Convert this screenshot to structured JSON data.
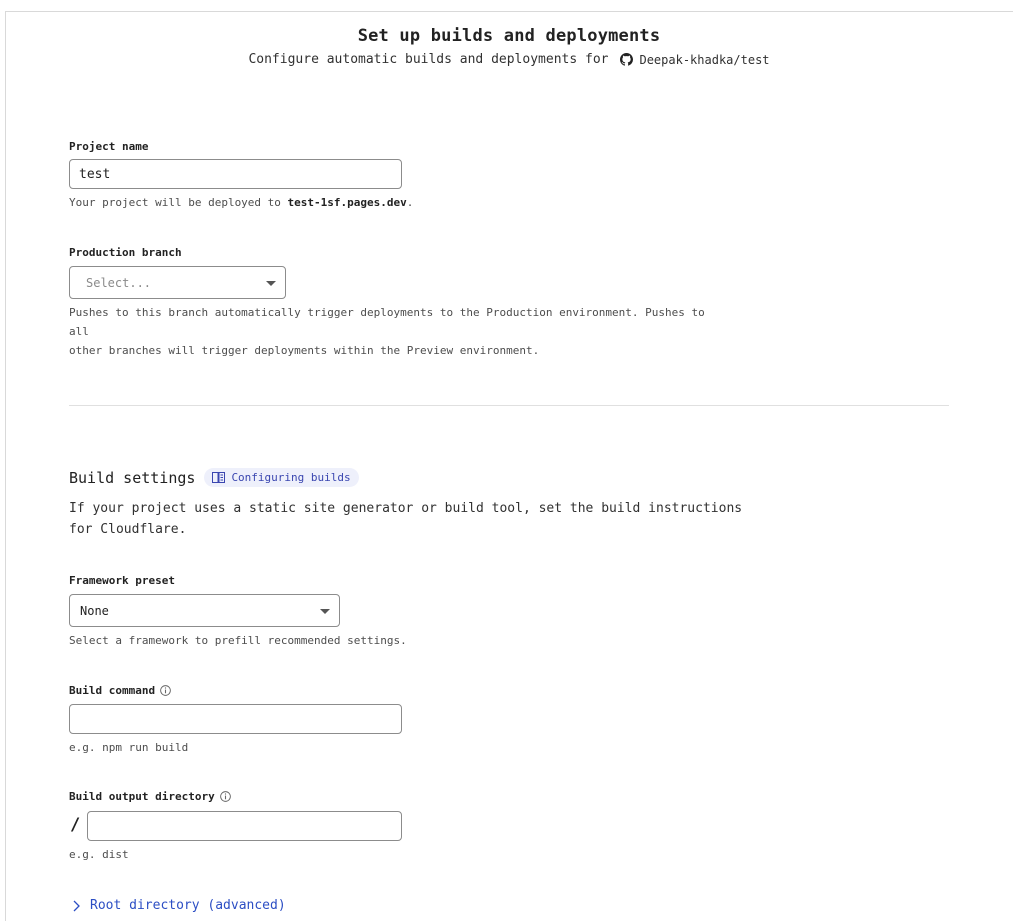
{
  "header": {
    "title": "Set up builds and deployments",
    "subtitle_prefix": "Configure automatic builds and deployments for",
    "repo": "Deepak-khadka/test",
    "repo_icon": "github-icon"
  },
  "project_name": {
    "label": "Project name",
    "value": "test",
    "help_prefix": "Your project will be deployed to ",
    "help_domain": "test-1sf.pages.dev",
    "help_suffix": "."
  },
  "production_branch": {
    "label": "Production branch",
    "placeholder": "Select...",
    "help_line1": "Pushes to this branch automatically trigger deployments to the Production environment. Pushes to all",
    "help_line2": "other branches will trigger deployments within the Preview environment."
  },
  "build_settings": {
    "title": "Build settings",
    "doc_link": "Configuring builds",
    "doc_icon": "book-icon",
    "desc_line1": "If your project uses a static site generator or build tool, set the build instructions",
    "desc_line2": "for Cloudflare."
  },
  "framework_preset": {
    "label": "Framework preset",
    "value": "None",
    "help": "Select a framework to prefill recommended settings."
  },
  "build_command": {
    "label": "Build command",
    "value": "",
    "help": "e.g. npm run build"
  },
  "build_output": {
    "label": "Build output directory",
    "prefix": "/",
    "value": "",
    "help": "e.g. dist"
  },
  "root_directory": {
    "label": "Root directory (advanced)"
  }
}
